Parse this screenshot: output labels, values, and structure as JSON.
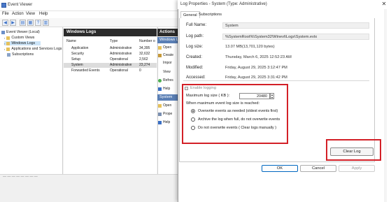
{
  "event_viewer": {
    "title": "Event Viewer",
    "menu": [
      "File",
      "Action",
      "View",
      "Help"
    ],
    "tree": {
      "root": "Event Viewer (Local)",
      "items": [
        "Custom Views",
        "Windows Logs",
        "Applications and Services Logs",
        "Subscriptions"
      ]
    },
    "center": {
      "header": "Windows Logs",
      "columns": [
        "Name",
        "Type",
        "Number o"
      ],
      "rows": [
        {
          "name": "Application",
          "type": "Administrative",
          "number": "34,395"
        },
        {
          "name": "Security",
          "type": "Administrative",
          "number": "32,632"
        },
        {
          "name": "Setup",
          "type": "Operational",
          "number": "2,562"
        },
        {
          "name": "System",
          "type": "Administrative",
          "number": "23,274"
        },
        {
          "name": "Forwarded Events",
          "type": "Operational",
          "number": "0"
        }
      ]
    },
    "actions": {
      "header": "Actions",
      "section1": "Windows L",
      "items1": [
        "Open",
        "Create",
        "Impor",
        "View",
        "Refres",
        "Help"
      ],
      "section2": "System",
      "items2": [
        "Open",
        "Prope",
        "Help"
      ]
    },
    "status_text": "— — — — — — — —"
  },
  "dialog": {
    "title": "Log Properties - System (Type: Administrative)",
    "close": "✕",
    "tabs": [
      "General",
      "Subscriptions"
    ],
    "fields": {
      "full_name_label": "Full Name:",
      "full_name": "System",
      "log_path_label": "Log path:",
      "log_path": "%SystemRoot%\\System32\\Winevt\\Logs\\System.evtx",
      "log_size_label": "Log size:",
      "log_size": "13.07 MB(13,701,120 bytes)",
      "created_label": "Created:",
      "created": "Thursday, March 6, 2025 12:52:23 AM",
      "modified_label": "Modified:",
      "modified": "Friday, August 29, 2025 3:12:47 PM",
      "accessed_label": "Accessed:",
      "accessed": "Friday, August 29, 2025 3:31:42 PM"
    },
    "enable_logging_label": "Enable logging",
    "max_size_label": "Maximum log size ( KB ):",
    "max_size_value": "20480",
    "when_reached_label": "When maximum event log size is reached:",
    "options": [
      "Overwrite events as needed (oldest events first)",
      "Archive the log when full, do not overwrite events",
      "Do not overwrite events ( Clear logs manually )"
    ],
    "selected_option": 0,
    "buttons": {
      "clear_log": "Clear Log",
      "ok": "OK",
      "cancel": "Cancel",
      "apply": "Apply"
    },
    "highlight_color": "#d32027"
  }
}
